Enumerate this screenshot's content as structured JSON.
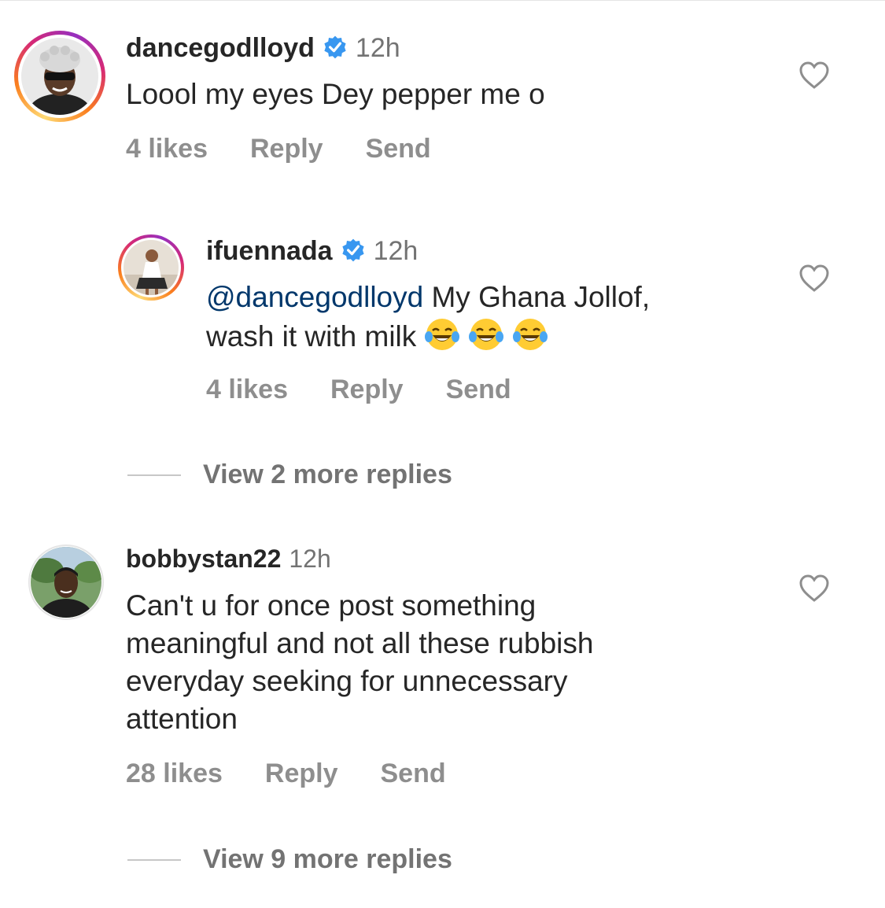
{
  "comments": [
    {
      "username": "dancegodlloyd",
      "verified": true,
      "time": "12h",
      "text": "Loool my eyes Dey pepper me o",
      "likes": "4 likes",
      "reply_label": "Reply",
      "send_label": "Send",
      "avatar_icon": "person-with-sunglasses-avatar"
    },
    {
      "username": "ifuennada",
      "verified": true,
      "time": "12h",
      "mention": "@dancegodlloyd",
      "text_line1": "My Ghana Jollof,",
      "text_line2": "wash it with milk",
      "emoji_icon": "face-with-tears-of-joy-icon",
      "emoji_count": 3,
      "likes": "4 likes",
      "reply_label": "Reply",
      "send_label": "Send",
      "avatar_icon": "woman-seated-avatar"
    },
    {
      "username": "bobbystan22",
      "verified": false,
      "time": "12h",
      "text_lines": [
        "Can't u for once post something",
        "meaningful and not all these rubbish",
        "everyday seeking for unnecessary",
        "attention"
      ],
      "likes": "28 likes",
      "reply_label": "Reply",
      "send_label": "Send",
      "avatar_icon": "man-outdoors-avatar"
    }
  ],
  "view_more": [
    "View 2 more replies",
    "View 9 more replies"
  ],
  "colors": {
    "verified_badge": "#3897f0",
    "mention": "#00376b",
    "muted": "#8e8e8e"
  }
}
